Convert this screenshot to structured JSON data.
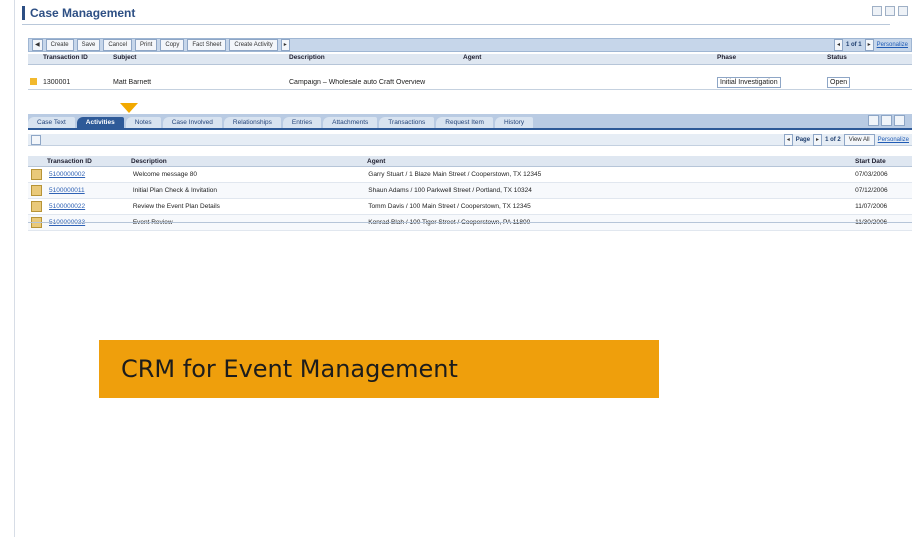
{
  "window": {
    "title": "Case Management"
  },
  "toolbar": {
    "buttons": [
      "Create",
      "Save",
      "Cancel",
      "Print",
      "Copy",
      "Fact Sheet",
      "Create Activity"
    ],
    "page_label": "1 of 1",
    "link": "Personalize"
  },
  "header": {
    "columns": [
      "Transaction ID",
      "Subject",
      "Description",
      "Agent",
      "Phase",
      "Status"
    ],
    "row": {
      "id": "1300001",
      "subject": "Matt Barnett",
      "description": "Campaign – Wholesale auto Craft Overview",
      "phase": "Initial Investigation",
      "status": "Open"
    }
  },
  "tabs": [
    "Case Text",
    "Activities",
    "Notes",
    "Case Involved",
    "Relationships",
    "Entries",
    "Attachments",
    "Transactions",
    "Request Item",
    "History"
  ],
  "active_tab": "Activities",
  "activities": {
    "pager": {
      "label": "Page",
      "count": "1 of 2",
      "view": "View All",
      "link": "Personalize"
    },
    "columns": [
      "Transaction ID",
      "Description",
      "Agent",
      "Start Date"
    ],
    "rows": [
      {
        "id": "5100000002",
        "description": "Welcome message 80",
        "agent": "Garry Stuart / 1 Blaze Main Street / Cooperstown, TX 12345",
        "date": "07/03/2006"
      },
      {
        "id": "5100000011",
        "description": "Initial Plan Check & Invitation",
        "agent": "Shaun Adams / 100 Parkwell Street / Portland, TX 10324",
        "date": "07/12/2006"
      },
      {
        "id": "5100000022",
        "description": "Review the Event Plan Details",
        "agent": "Tomm Davis / 100 Main Street / Cooperstown, TX 12345",
        "date": "11/07/2006"
      },
      {
        "id": "5100000033",
        "description": "Event Review",
        "agent": "Konrad Blah / 100 Tiger Street / Cooperstown, PA 11800",
        "date": "11/30/2006"
      }
    ]
  },
  "callout": {
    "text": "CRM for Event Management"
  },
  "colors": {
    "accent": "#ef9f0c",
    "tab_active": "#2e5a98",
    "toolbar_bg": "#c6d6ea"
  }
}
